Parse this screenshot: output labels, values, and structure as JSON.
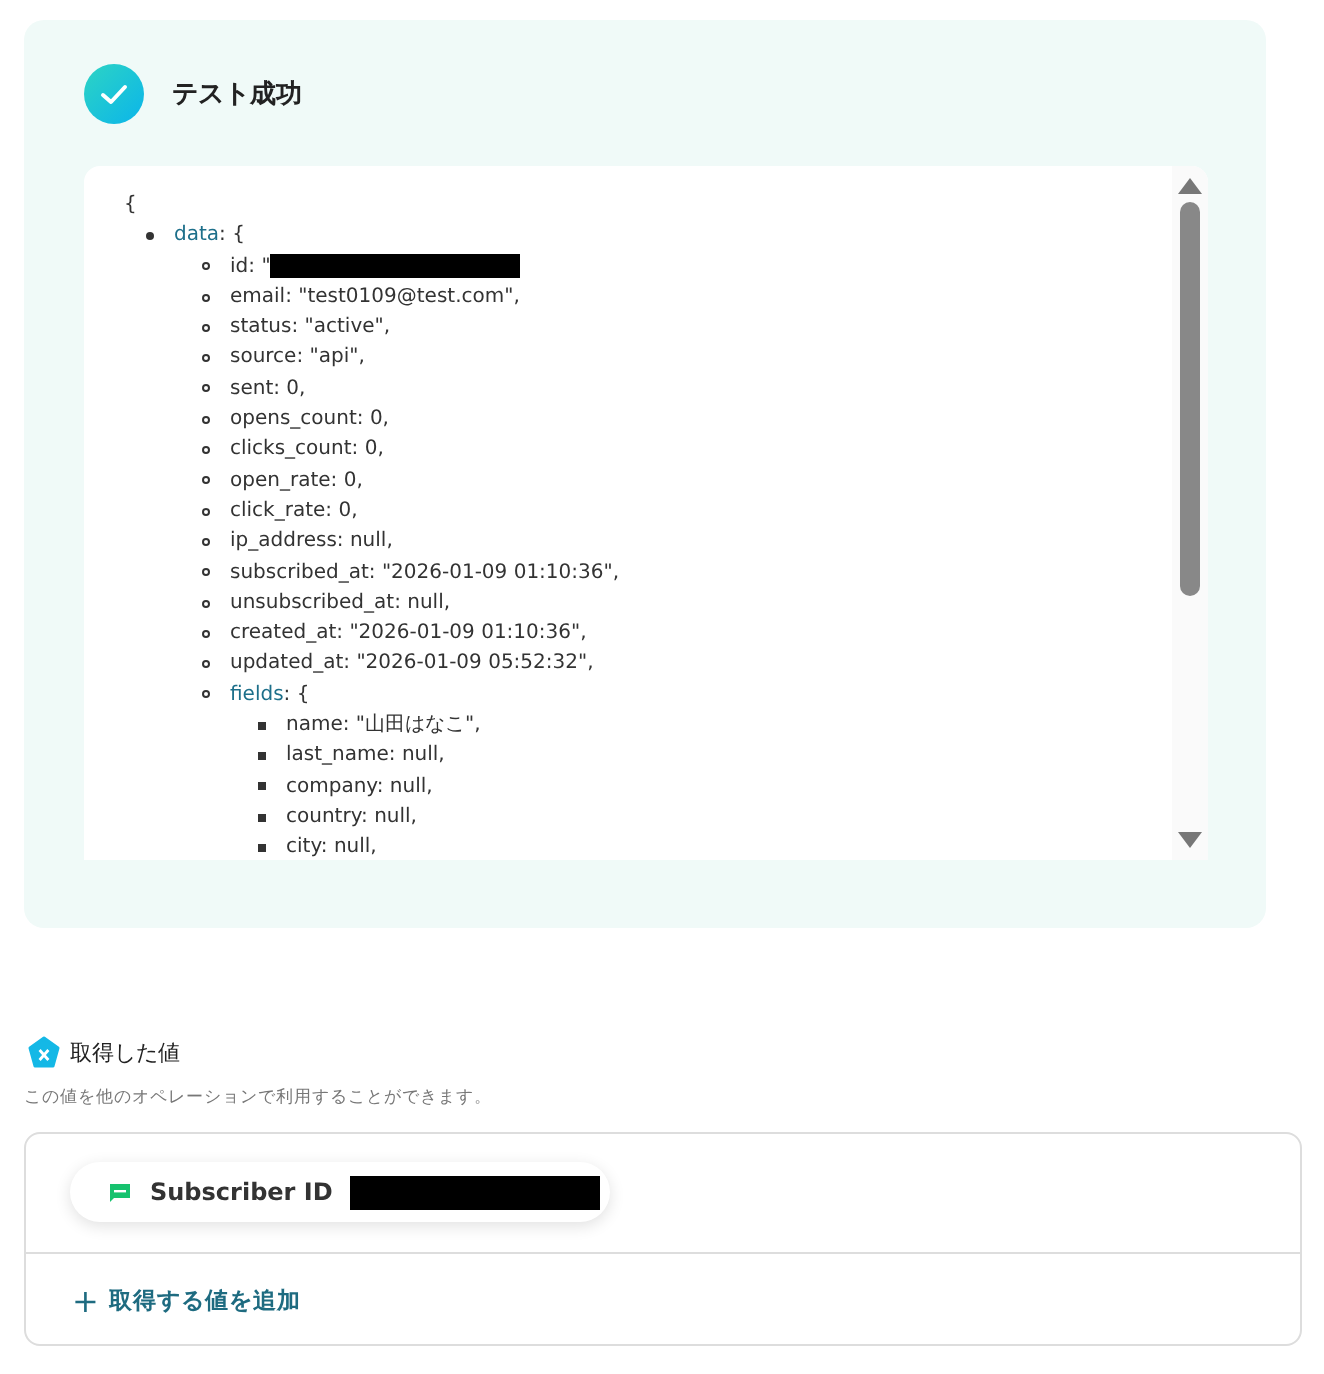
{
  "result": {
    "title": "テスト成功",
    "json_open": "{",
    "tree": [
      {
        "key": "data",
        "value": ": {",
        "children": [
          {
            "key": "id",
            "value": ": \"",
            "redacted": true
          },
          {
            "key": "email",
            "value": ": \"test0109@test.com\","
          },
          {
            "key": "status",
            "value": ": \"active\","
          },
          {
            "key": "source",
            "value": ": \"api\","
          },
          {
            "key": "sent",
            "value": ": 0,"
          },
          {
            "key": "opens_count",
            "value": ": 0,"
          },
          {
            "key": "clicks_count",
            "value": ": 0,"
          },
          {
            "key": "open_rate",
            "value": ": 0,"
          },
          {
            "key": "click_rate",
            "value": ": 0,"
          },
          {
            "key": "ip_address",
            "value": ": null,"
          },
          {
            "key": "subscribed_at",
            "value": ": \"2026-01-09 01:10:36\","
          },
          {
            "key": "unsubscribed_at",
            "value": ": null,"
          },
          {
            "key": "created_at",
            "value": ": \"2026-01-09 01:10:36\","
          },
          {
            "key": "updated_at",
            "value": ": \"2026-01-09 05:52:32\","
          },
          {
            "key": "fields",
            "value": ": {",
            "children": [
              {
                "key": "name",
                "value": ": \"山田はなこ\","
              },
              {
                "key": "last_name",
                "value": ": null,"
              },
              {
                "key": "company",
                "value": ": null,"
              },
              {
                "key": "country",
                "value": ": null,"
              },
              {
                "key": "city",
                "value": ": null,"
              }
            ]
          }
        ]
      }
    ]
  },
  "values": {
    "title": "取得した値",
    "description": "この値を他のオペレーションで利用することができます。",
    "items": [
      {
        "label": "Subscriber ID",
        "redacted": true
      }
    ],
    "add_label": "取得する値を追加",
    "add_icon": "+"
  }
}
